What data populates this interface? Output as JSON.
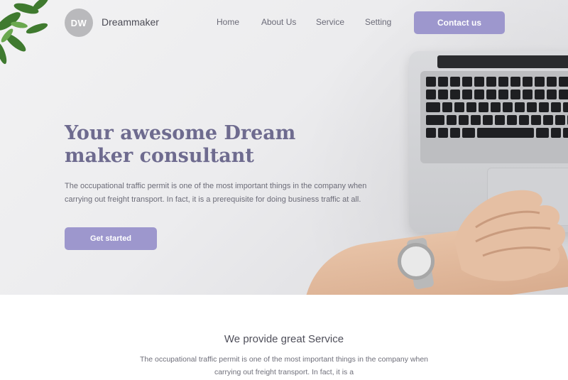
{
  "header": {
    "logo_text": "DW",
    "brand_name": "Dreammaker",
    "nav": [
      "Home",
      "About Us",
      "Service",
      "Setting"
    ],
    "contact_label": "Contact us"
  },
  "hero": {
    "title": "Your awesome Dream maker consultant",
    "description": "The occupational traffic permit is one of the most important things in the company when carrying out freight transport. In fact, it is a prerequisite for doing business traffic at all.",
    "cta_label": "Get started"
  },
  "service": {
    "title": "We provide great Service",
    "description": "The occupational traffic permit is one of the most important things in the company when carrying out freight transport. In fact, it is a"
  },
  "colors": {
    "accent": "#9d97cd",
    "headline": "#6e6b8f",
    "text": "#6c6c78"
  }
}
